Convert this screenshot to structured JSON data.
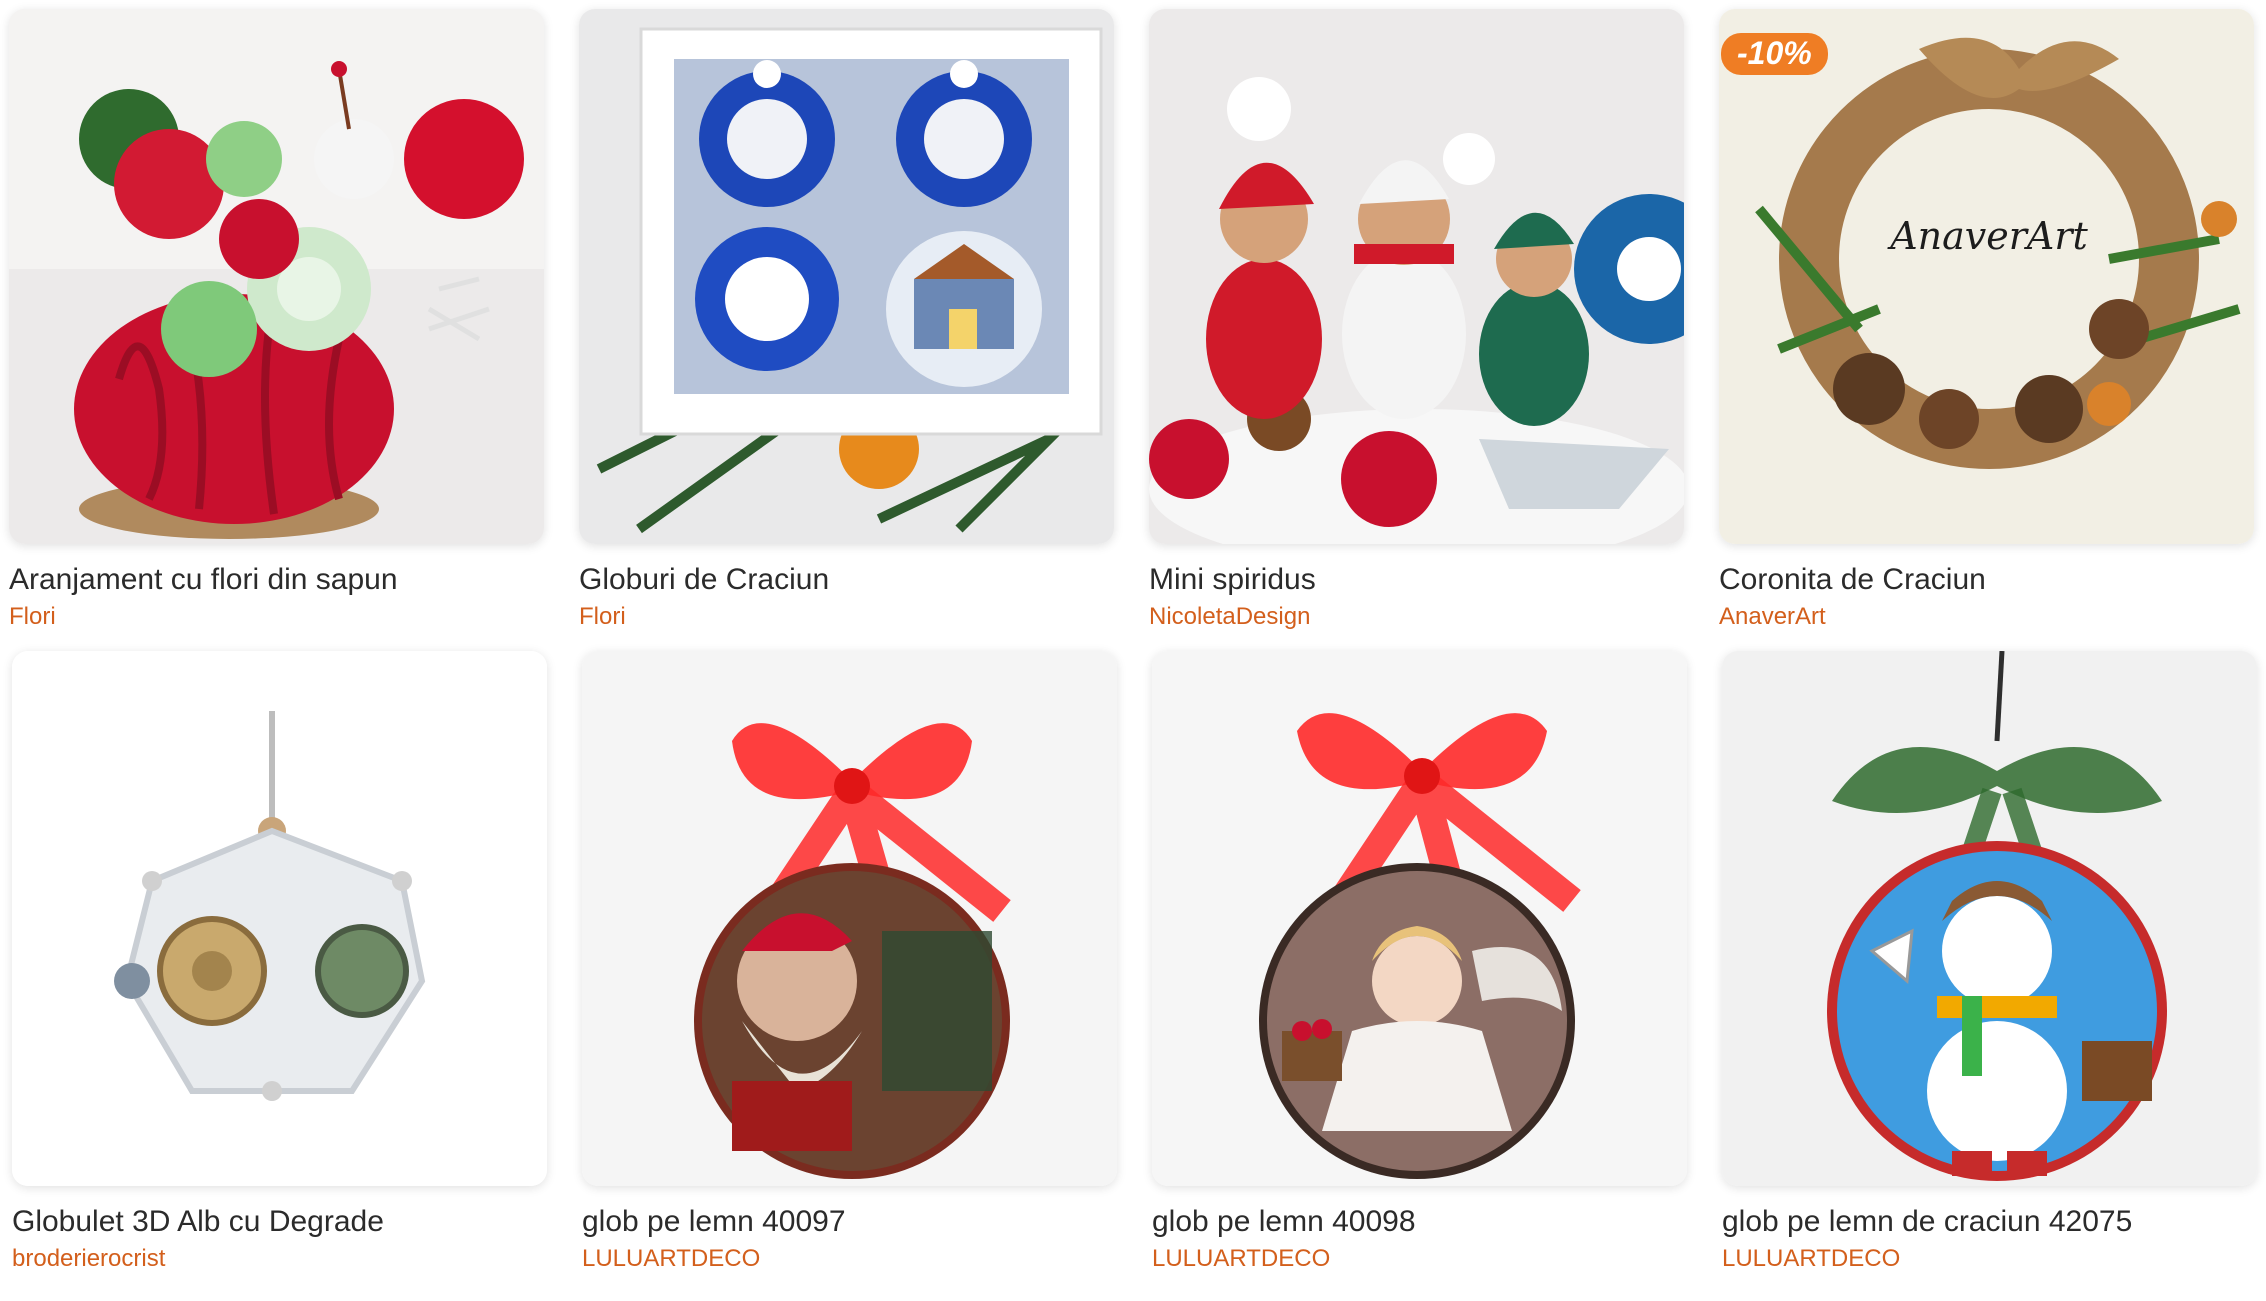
{
  "products": [
    {
      "title": "Aranjament cu flori din sapun",
      "seller": "Flori",
      "badge": null,
      "image": "soap-flower-arrangement"
    },
    {
      "title": "Globuri de Craciun",
      "seller": "Flori",
      "badge": null,
      "image": "christmas-ornaments-box"
    },
    {
      "title": "Mini spiridus",
      "seller": "NicoletaDesign",
      "badge": null,
      "image": "crochet-elves"
    },
    {
      "title": "Coronita de Craciun",
      "seller": "AnaverArt",
      "badge": "-10%",
      "image": "christmas-wreath",
      "image_text": "AnaverArt"
    },
    {
      "title": "Globulet 3D Alb cu Degrade",
      "seller": "broderierocrist",
      "badge": null,
      "image": "lace-ornament"
    },
    {
      "title": "glob pe lemn 40097",
      "seller": "LULUARTDECO",
      "badge": null,
      "image": "wood-ornament-santa"
    },
    {
      "title": "glob pe lemn 40098",
      "seller": "LULUARTDECO",
      "badge": null,
      "image": "wood-ornament-angel"
    },
    {
      "title": "glob pe lemn de craciun 42075",
      "seller": "LULUARTDECO",
      "badge": null,
      "image": "wood-ornament-snowman"
    }
  ],
  "colors": {
    "seller_link": "#d35f1c",
    "badge_bg": "#ef7d24",
    "title_text": "#2b2b2b"
  }
}
